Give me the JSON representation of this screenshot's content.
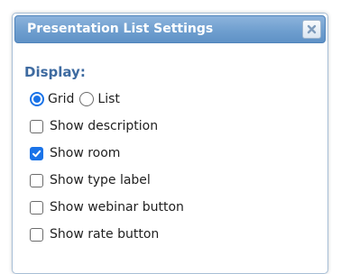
{
  "dialog": {
    "title": "Presentation List Settings",
    "close_icon": "close-x-icon"
  },
  "display": {
    "heading": "Display:",
    "view_options": [
      {
        "label": "Grid",
        "selected": true
      },
      {
        "label": "List",
        "selected": false
      }
    ],
    "checkboxes": [
      {
        "label": "Show description",
        "checked": false
      },
      {
        "label": "Show room",
        "checked": true
      },
      {
        "label": "Show type label",
        "checked": false
      },
      {
        "label": "Show webinar button",
        "checked": false
      },
      {
        "label": "Show rate button",
        "checked": false
      }
    ]
  },
  "colors": {
    "titlebar": "#6f9fcf",
    "heading": "#3d6aa0",
    "accent": "#1a73e8"
  }
}
